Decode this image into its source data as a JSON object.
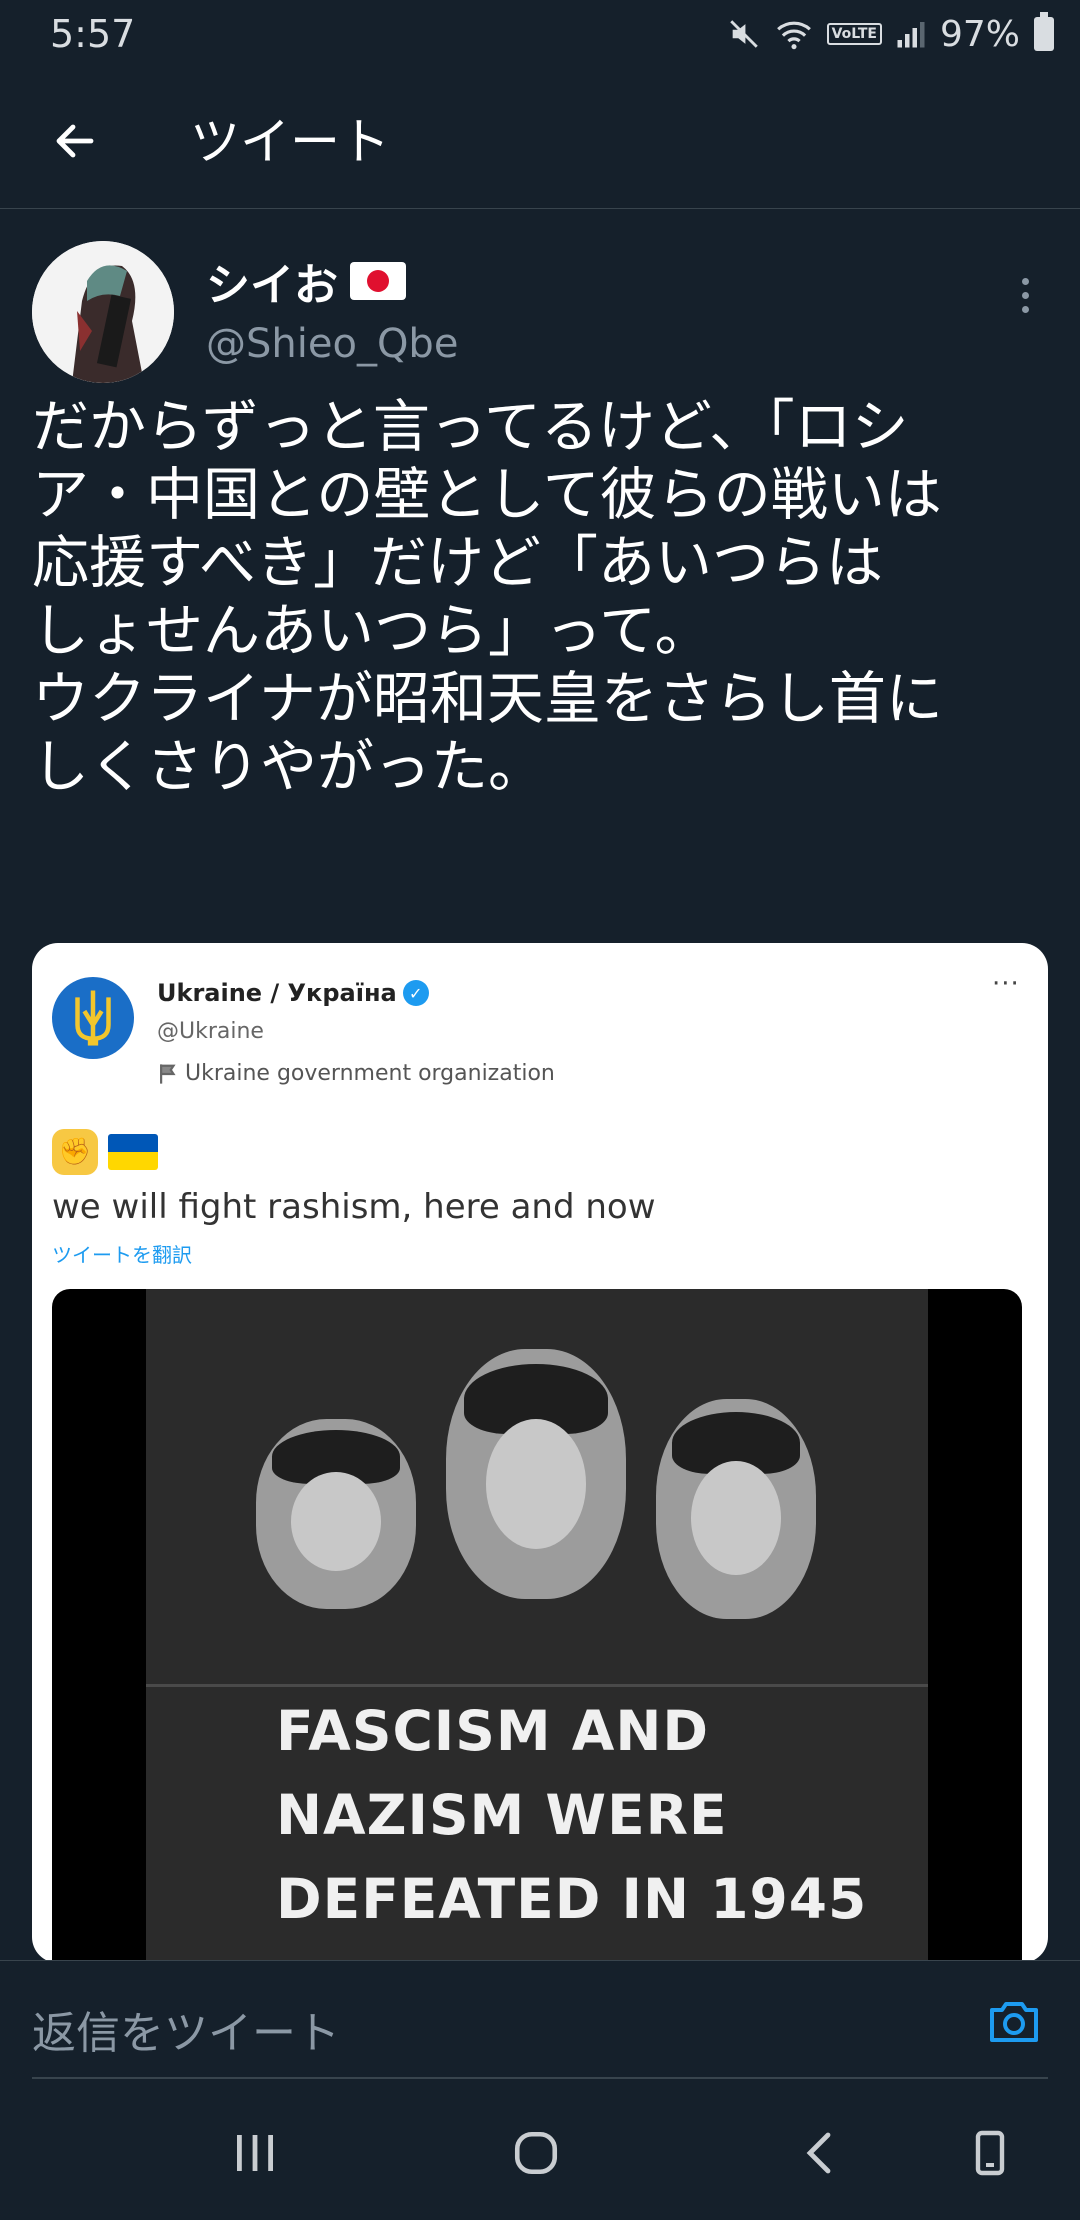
{
  "status_bar": {
    "time": "5:57",
    "network_label": "VoLTE",
    "battery": "97%"
  },
  "header": {
    "title": "ツイート"
  },
  "tweet": {
    "display_name": "シイお",
    "handle": "@Shieo_Qbe",
    "text": "だからずっと言ってるけど、「ロシ\nア・中国との壁として彼らの戦いは\n応援すべき」だけど「あいつらは\nしょせんあいつら」って。\nウクライナが昭和天皇をさらし首に\nしくさりやがった。"
  },
  "quote": {
    "name": "Ukraine / Україна",
    "handle": "@Ukraine",
    "org_label": "Ukraine government organization",
    "text": "we will fight rashism, here and now",
    "translate": "ツイートを翻訳",
    "media_text_line1": "FASCISM AND",
    "media_text_line2": "NAZISM WERE",
    "media_text_line3": "DEFEATED IN 1945"
  },
  "reply": {
    "placeholder": "返信をツイート"
  },
  "colors": {
    "background": "#15202b",
    "accent": "#1d9bf0",
    "secondary_text": "#8b98a5"
  }
}
